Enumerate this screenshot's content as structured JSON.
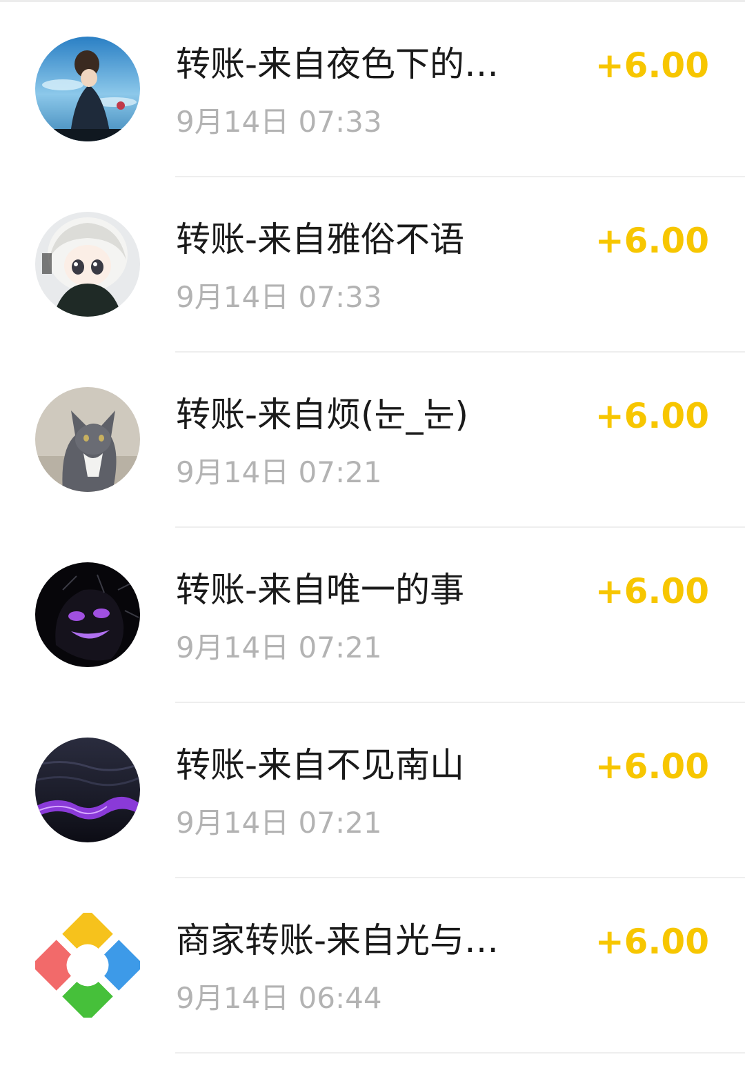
{
  "transactions": [
    {
      "title": "转账-来自夜色下的…",
      "time": "9月14日 07:33",
      "amount": "+6.00",
      "avatar_icon": "anime-figure-sky-avatar"
    },
    {
      "title": "转账-来自雅俗不语",
      "time": "9月14日 07:33",
      "amount": "+6.00",
      "avatar_icon": "anime-girl-white-hair-avatar"
    },
    {
      "title": "转账-来自烦(눈_눈)",
      "time": "9月14日 07:21",
      "amount": "+6.00",
      "avatar_icon": "gray-cat-avatar"
    },
    {
      "title": "转账-来自唯一的事",
      "time": "9月14日 07:21",
      "amount": "+6.00",
      "avatar_icon": "purple-ghost-avatar"
    },
    {
      "title": "转账-来自不见南山",
      "time": "9月14日 07:21",
      "amount": "+6.00",
      "avatar_icon": "dark-sea-purple-avatar"
    },
    {
      "title": "商家转账-来自光与…",
      "time": "9月14日 06:44",
      "amount": "+6.00",
      "avatar_icon": "merchant-logo-icon"
    }
  ],
  "colors": {
    "amount": "#f7c600",
    "title": "#1a1a1a",
    "time": "#b3b3b3",
    "divider": "#eeeeee"
  }
}
